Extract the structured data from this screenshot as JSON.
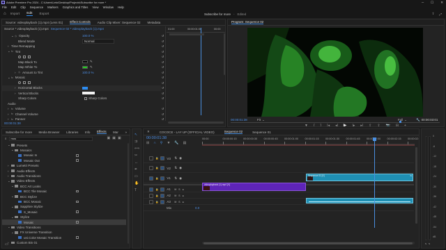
{
  "window": {
    "title": "Adobe Premiere Pro 2024 - C:\\Users\\Leto\\Desktop\\Projects\\Subscribe for more *",
    "menu": [
      "File",
      "Edit",
      "Clip",
      "Sequence",
      "Markers",
      "Graphics and Titles",
      "View",
      "Window",
      "Help"
    ],
    "workspaces": [
      "Import",
      "Edit",
      "Export"
    ],
    "active_workspace": "Edit",
    "project_label": "Subscribe for more",
    "project_status": "Edited"
  },
  "source_panel": {
    "tabs": [
      "Source: videoplayback (1).mp4 (Lens 01)",
      "Effect Controls",
      "Audio Clip Mixer: Sequence 02",
      "Metadata"
    ],
    "clip_label": "Source * videoplayback (1).mp4",
    "sequence_label": "Sequence 02 * videoplayback (1).mp4",
    "timecode": "00:00:01:38",
    "ruler": [
      "01:00",
      "00:00:01:00",
      "00:00"
    ],
    "rows": [
      {
        "label": "Opacity",
        "value": "100.0 %",
        "indent": 2,
        "twirl": "⌄"
      },
      {
        "label": "Blend Mode",
        "value": "Normal",
        "indent": 3,
        "twirl": ""
      },
      {
        "label": "Time Remapping",
        "value": "",
        "indent": 1,
        "twirl": "›"
      },
      {
        "label": "Tint",
        "value": "",
        "indent": 1,
        "twirl": "⌄"
      },
      {
        "label": "",
        "value": "",
        "indent": 3,
        "twirl": ""
      },
      {
        "label": "Map Black To",
        "value": "",
        "indent": 3,
        "twirl": ""
      },
      {
        "label": "Map White To",
        "value": "",
        "indent": 3,
        "twirl": ""
      },
      {
        "label": "Amount to Tint",
        "value": "100.0 %",
        "indent": 3,
        "twirl": "›"
      },
      {
        "label": "Mosaic",
        "value": "",
        "indent": 1,
        "twirl": "⌄"
      },
      {
        "label": "",
        "value": "",
        "indent": 3,
        "twirl": ""
      },
      {
        "label": "Horizontal Blocks",
        "value": "",
        "indent": 3,
        "twirl": "›"
      },
      {
        "label": "Vertical Blocks",
        "value": "",
        "indent": 3,
        "twirl": "›"
      },
      {
        "label": "Sharp Colors",
        "value": "",
        "indent": 3,
        "twirl": ""
      },
      {
        "label": "Audio",
        "value": "",
        "indent": 0,
        "twirl": ""
      },
      {
        "label": "Volume",
        "value": "",
        "indent": 1,
        "twirl": "›"
      },
      {
        "label": "Channel Volume",
        "value": "",
        "indent": 1,
        "twirl": "›"
      },
      {
        "label": "Panner",
        "value": "",
        "indent": 1,
        "twirl": "›"
      }
    ],
    "tint_black": "#000000",
    "tint_white": "#22d11e",
    "sharp_colors_label": "Sharp Colors"
  },
  "program": {
    "title": "Program: Sequence 02",
    "timecode": "00:00:01:38",
    "fit": "Fit",
    "quality": "Full",
    "duration": "00:00:03:01"
  },
  "effects_panel": {
    "tabs": [
      "Subscribe for more",
      "Media Browser",
      "Libraries",
      "Info",
      "Effects",
      "Mar",
      "»"
    ],
    "active_tab": "Effects",
    "search_value": "mos",
    "tree": [
      {
        "label": "Presets",
        "indent": 1,
        "twirl": "⌄"
      },
      {
        "label": "Mosaics",
        "indent": 2,
        "twirl": "⌄"
      },
      {
        "label": "Mosaic In",
        "indent": 3,
        "twirl": ""
      },
      {
        "label": "Mosaic Out",
        "indent": 3,
        "twirl": ""
      },
      {
        "label": "Lumetri Presets",
        "indent": 1,
        "twirl": "›"
      },
      {
        "label": "Audio Effects",
        "indent": 1,
        "twirl": "›"
      },
      {
        "label": "Audio Transitions",
        "indent": 1,
        "twirl": "›"
      },
      {
        "label": "Video Effects",
        "indent": 1,
        "twirl": "⌄"
      },
      {
        "label": "BCC Art Looks",
        "indent": 2,
        "twirl": "⌄"
      },
      {
        "label": "BCC Tile Mosaic",
        "indent": 3,
        "twirl": ""
      },
      {
        "label": "BCC Stylize",
        "indent": 2,
        "twirl": "⌄"
      },
      {
        "label": "BCC Mosaic",
        "indent": 3,
        "twirl": ""
      },
      {
        "label": "Sapphire Stylize",
        "indent": 2,
        "twirl": "⌄"
      },
      {
        "label": "S_Mosaic",
        "indent": 3,
        "twirl": ""
      },
      {
        "label": "Stylize",
        "indent": 2,
        "twirl": "⌄"
      },
      {
        "label": "Mosaic",
        "indent": 3,
        "twirl": "",
        "selected": true
      },
      {
        "label": "Video Transitions",
        "indent": 1,
        "twirl": "⌄"
      },
      {
        "label": "FX Universe Transition",
        "indent": 2,
        "twirl": "⌄"
      },
      {
        "label": "uni.Color Mosaic Transition",
        "indent": 3,
        "twirl": ""
      },
      {
        "label": "Custom Bin 01",
        "indent": 1,
        "twirl": "›"
      }
    ]
  },
  "timeline": {
    "tabs": [
      "COCOCE - LAY UP (OFFICIAL VIDEO)",
      "Sequence 02",
      "Sequence 01"
    ],
    "active_tab": "Sequence 02",
    "timecode": "00:00:01:38",
    "ruler": [
      "00:00",
      "00:00:00:15",
      "00:00:00:30",
      "00:00:00:45",
      "00:00:01:00",
      "00:00:01:15",
      "00:00:01:30",
      "00:00:01:45",
      "00:00:02:00",
      "00:00:02:15",
      "00:00:02:30"
    ],
    "tracks": [
      {
        "name": "V3",
        "kind": "video"
      },
      {
        "name": "V2",
        "kind": "video"
      },
      {
        "name": "V1",
        "kind": "video"
      },
      {
        "name": "A1",
        "kind": "audio"
      },
      {
        "name": "A2",
        "kind": "audio"
      },
      {
        "name": "A3",
        "kind": "audio"
      },
      {
        "name": "Mix",
        "kind": "mix"
      }
    ],
    "mix_value": "0.0",
    "clips": {
      "v2": "Sequence 01 [V]",
      "v1": "videoplayback (1).mp4 [V]"
    }
  },
  "meter": {
    "scale": [
      "0",
      "-6",
      "-12",
      "-18",
      "-24",
      "-30",
      "-36",
      "-42",
      "-48",
      "-54",
      "dB"
    ]
  },
  "colors": {
    "accent_blue": "#2d8cf0",
    "playhead": "#4a90e2",
    "clip_purple": "#5e24b8",
    "clip_teal": "#1f8fb3",
    "workspace_active": "#e8e8e8"
  }
}
